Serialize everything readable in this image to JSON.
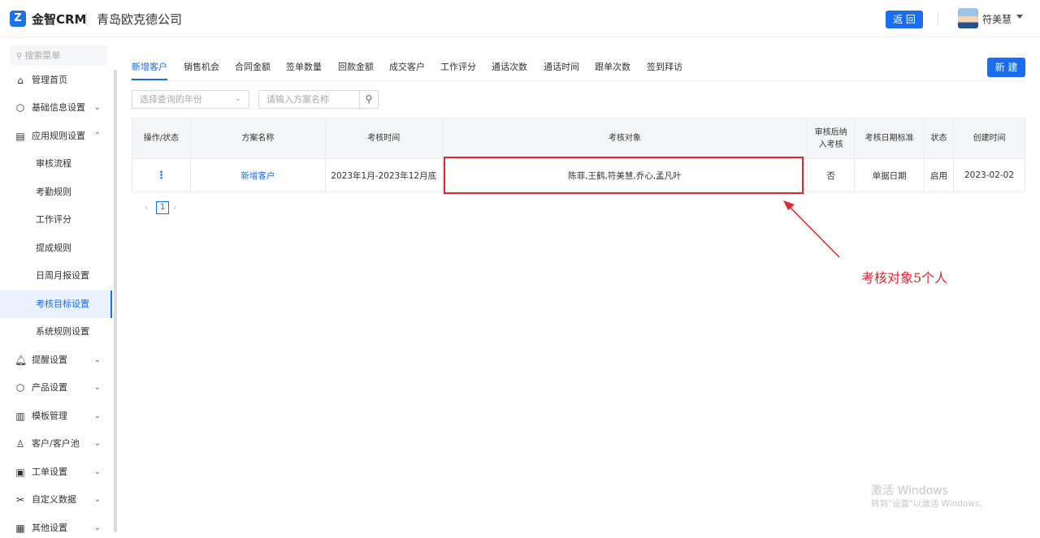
{
  "header": {
    "logo_glyph": "Z",
    "brand": "金智CRM",
    "company": "青岛欧克德公司",
    "back_label": "返 回",
    "username": "符美慧"
  },
  "sidebar": {
    "search_placeholder": "搜索菜单",
    "items": [
      {
        "label": "管理首页",
        "icon": "home-icon"
      },
      {
        "label": "基础信息设置",
        "icon": "cube-icon"
      },
      {
        "label": "应用规则设置",
        "icon": "document-icon"
      },
      {
        "label": "提醒设置",
        "icon": "bell-icon"
      },
      {
        "label": "产品设置",
        "icon": "box-icon"
      },
      {
        "label": "模板管理",
        "icon": "template-icon"
      },
      {
        "label": "客户/客户池",
        "icon": "user-icon"
      },
      {
        "label": "工单设置",
        "icon": "ticket-icon"
      },
      {
        "label": "自定义数据",
        "icon": "tools-icon"
      },
      {
        "label": "其他设置",
        "icon": "grid-icon"
      }
    ],
    "subitems": [
      "审核流程",
      "考勤规则",
      "工作评分",
      "提成规则",
      "日周月报设置",
      "考核目标设置",
      "系统规则设置"
    ],
    "active_subitem": "考核目标设置"
  },
  "tabs": [
    "新增客户",
    "销售机会",
    "合同金额",
    "签单数量",
    "回款金额",
    "成交客户",
    "工作评分",
    "通话次数",
    "通话时间",
    "跟单次数",
    "签到拜访"
  ],
  "active_tab": "新增客户",
  "new_button": "新 建",
  "filters": {
    "year_placeholder": "选择查询的年份",
    "name_placeholder": "请输入方案名称"
  },
  "table": {
    "headers": [
      "操作/状态",
      "方案名称",
      "考核时间",
      "考核对象",
      "审核后纳入考核",
      "考核日期标准",
      "状态",
      "创建时间"
    ],
    "header_wrapped": [
      "审核后纳",
      "入考核"
    ],
    "rows": [
      {
        "action": "⋮",
        "name": "新增客户",
        "period": "2023年1月-2023年12月底",
        "targets": "陈菲,王鹤,符美慧,乔心,孟凡叶",
        "review_included": "否",
        "date_standard": "单据日期",
        "status": "启用",
        "created": "2023-02-02"
      }
    ]
  },
  "pager": {
    "current": "1"
  },
  "annotation": {
    "text": "考核对象5个人",
    "color": "#e5252a"
  },
  "watermark": {
    "line1": "激活 Windows",
    "line2": "转到\"设置\"以激活 Windows。"
  },
  "colors": {
    "primary": "#1a6cf0",
    "annotation": "#e5252a"
  }
}
